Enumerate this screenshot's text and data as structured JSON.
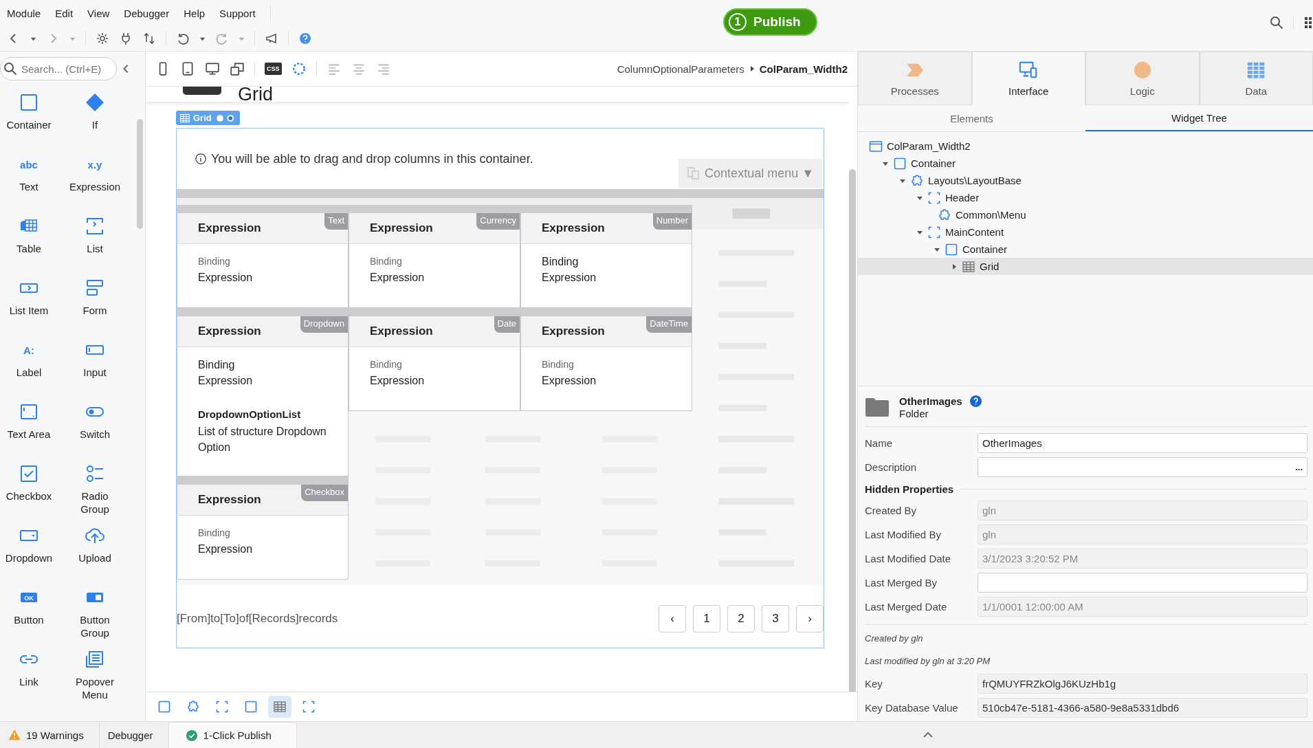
{
  "menu": [
    "Module",
    "Edit",
    "View",
    "Debugger",
    "Help",
    "Support"
  ],
  "publish": {
    "count": "1",
    "label": "Publish"
  },
  "palette": {
    "search_placeholder": "Search... (Ctrl+E)",
    "items": [
      {
        "label": "Container",
        "kind": "container"
      },
      {
        "label": "If",
        "kind": "diamond"
      },
      {
        "label": "Text",
        "kind": "glyph",
        "glyph": "abc"
      },
      {
        "label": "Expression",
        "kind": "glyph",
        "glyph": "x.y"
      },
      {
        "label": "Table",
        "kind": "table"
      },
      {
        "label": "List",
        "kind": "list"
      },
      {
        "label": "List Item",
        "kind": "listitem"
      },
      {
        "label": "Form",
        "kind": "form"
      },
      {
        "label": "Label",
        "kind": "glyph",
        "glyph": "A:"
      },
      {
        "label": "Input",
        "kind": "input"
      },
      {
        "label": "Text Area",
        "kind": "textarea"
      },
      {
        "label": "Switch",
        "kind": "switch"
      },
      {
        "label": "Checkbox",
        "kind": "checkbox"
      },
      {
        "label": "Radio Group",
        "kind": "radio"
      },
      {
        "label": "Dropdown",
        "kind": "dropdown"
      },
      {
        "label": "Upload",
        "kind": "upload"
      },
      {
        "label": "Button",
        "kind": "badge",
        "glyph": "OK"
      },
      {
        "label": "Button Group",
        "kind": "buttongroup"
      },
      {
        "label": "Link",
        "kind": "link"
      },
      {
        "label": "Popover Menu",
        "kind": "popover"
      }
    ]
  },
  "canvas_toolbar": {
    "css_badge": "CSS"
  },
  "breadcrumb": {
    "parent": "ColumnOptionalParameters",
    "current": "ColParam_Width2"
  },
  "canvas": {
    "page_title": "Grid",
    "widget_tag": "Grid",
    "info": "You will be able to drag and drop columns in this container.",
    "contextual_menu": "Contextual menu ▼",
    "cards": [
      {
        "title": "Expression",
        "tag": "Text",
        "lines": [
          {
            "text": "Binding",
            "kind": "small"
          },
          {
            "text": "Expression",
            "kind": "normal"
          }
        ]
      },
      {
        "title": "Expression",
        "tag": "Currency",
        "lines": [
          {
            "text": "Binding",
            "kind": "small"
          },
          {
            "text": "Expression",
            "kind": "normal"
          }
        ]
      },
      {
        "title": "Expression",
        "tag": "Number",
        "lines": [
          {
            "text": "Binding",
            "kind": "normal"
          },
          {
            "text": "Expression",
            "kind": "normal"
          }
        ]
      },
      {
        "title": "Expression",
        "tag": "Dropdown",
        "lines": [
          {
            "text": "Binding",
            "kind": "normal"
          },
          {
            "text": "Expression",
            "kind": "normal"
          },
          {
            "text": "DropdownOptionList",
            "kind": "section"
          },
          {
            "text": "List of structure Dropdown Option",
            "kind": "normal"
          }
        ]
      },
      {
        "title": "Expression",
        "tag": "Date",
        "lines": [
          {
            "text": "Binding",
            "kind": "small"
          },
          {
            "text": "Expression",
            "kind": "normal"
          }
        ]
      },
      {
        "title": "Expression",
        "tag": "DateTime",
        "lines": [
          {
            "text": "Binding",
            "kind": "small"
          },
          {
            "text": "Expression",
            "kind": "normal"
          }
        ]
      },
      {
        "title": "Expression",
        "tag": "Checkbox",
        "lines": [
          {
            "text": "Binding",
            "kind": "small"
          },
          {
            "text": "Expression",
            "kind": "normal"
          }
        ]
      }
    ],
    "records": "[From]to[To]of[Records]records",
    "pages": [
      "‹",
      "1",
      "2",
      "3",
      "›"
    ]
  },
  "path_icons": [
    {
      "kind": "container",
      "selected": false
    },
    {
      "kind": "block",
      "selected": false
    },
    {
      "kind": "placeholder",
      "selected": false
    },
    {
      "kind": "container",
      "selected": false
    },
    {
      "kind": "table",
      "selected": true
    },
    {
      "kind": "placeholder",
      "selected": false
    }
  ],
  "right_tabs": [
    {
      "label": "Processes",
      "kind": "processes",
      "selected": false
    },
    {
      "label": "Interface",
      "kind": "interface",
      "selected": true
    },
    {
      "label": "Logic",
      "kind": "logic",
      "selected": false
    },
    {
      "label": "Data",
      "kind": "data",
      "selected": false
    }
  ],
  "sub_tabs": [
    {
      "label": "Elements",
      "selected": false
    },
    {
      "label": "Widget Tree",
      "selected": true
    }
  ],
  "tree": [
    {
      "label": "ColParam_Width2",
      "kind": "screen",
      "selected": false,
      "children": [
        {
          "label": "Container",
          "kind": "container",
          "expanded": true,
          "selected": false,
          "children": [
            {
              "label": "Layouts\\LayoutBase",
              "kind": "block",
              "expanded": true,
              "selected": false,
              "children": [
                {
                  "label": "Header",
                  "kind": "placeholder",
                  "expanded": true,
                  "selected": false,
                  "children": [
                    {
                      "label": "Common\\Menu",
                      "kind": "block",
                      "selected": false
                    }
                  ]
                },
                {
                  "label": "MainContent",
                  "kind": "placeholder",
                  "expanded": true,
                  "selected": false,
                  "children": [
                    {
                      "label": "Container",
                      "kind": "container",
                      "expanded": true,
                      "selected": false,
                      "children": [
                        {
                          "label": "Grid",
                          "kind": "table",
                          "expanded": false,
                          "selected": true
                        }
                      ]
                    }
                  ]
                }
              ]
            }
          ]
        }
      ]
    }
  ],
  "properties": {
    "title": "OtherImages",
    "type": "Folder",
    "fields": [
      {
        "label": "Name",
        "value": "OtherImages",
        "kind": "input"
      },
      {
        "label": "Description",
        "kind": "editor",
        "button": "..."
      }
    ],
    "section": "Hidden Properties",
    "hidden_fields": [
      {
        "label": "Created By",
        "value": "gln",
        "kind": "readonly"
      },
      {
        "label": "Last Modified By",
        "value": "gln",
        "kind": "readonly"
      },
      {
        "label": "Last Modified Date",
        "value": "3/1/2023 3:20:52 PM",
        "kind": "readonly"
      },
      {
        "label": "Last Merged By",
        "kind": "input"
      },
      {
        "label": "Last Merged Date",
        "value": "1/1/0001 12:00:00 AM",
        "kind": "readonly"
      }
    ],
    "notes": [
      "Created by gln",
      "Last modified by gln at 3:20 PM"
    ],
    "key_fields": [
      {
        "label": "Key",
        "value": "frQMUYFRZkOlgJ6KUzHb1g",
        "kind": "key"
      },
      {
        "label": "Key Database Value",
        "value": "510cb47e-5181-4366-a580-9e8a5331dbd6",
        "kind": "key"
      }
    ]
  },
  "status_bar": [
    {
      "label": "19 Warnings",
      "kind": "warning",
      "selected": false
    },
    {
      "label": "Debugger",
      "kind": "plain",
      "selected": false
    },
    {
      "label": "1-Click Publish",
      "kind": "success",
      "selected": true
    }
  ]
}
